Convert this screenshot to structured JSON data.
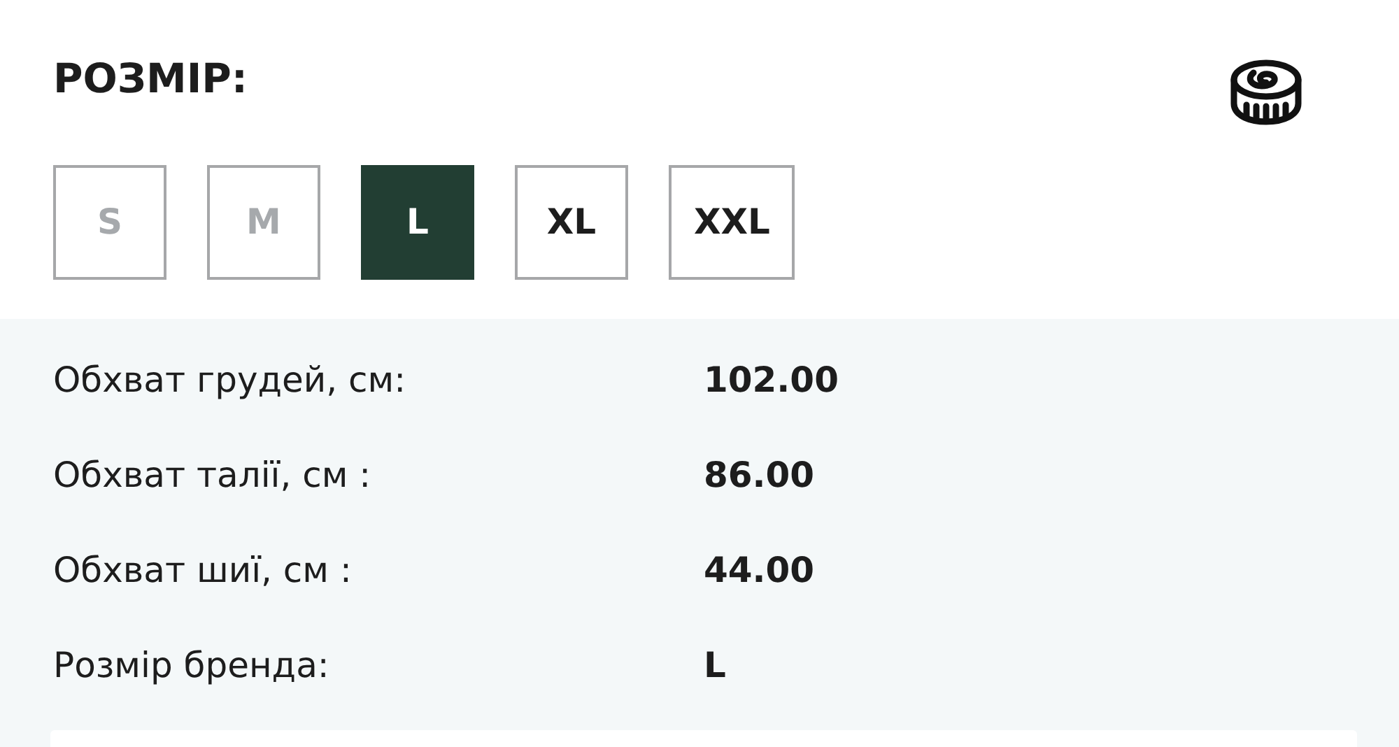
{
  "heading": "РОЗМІР:",
  "sizes": [
    {
      "label": "S",
      "selected": false,
      "disabled": true
    },
    {
      "label": "M",
      "selected": false,
      "disabled": true
    },
    {
      "label": "L",
      "selected": true,
      "disabled": false
    },
    {
      "label": "XL",
      "selected": false,
      "disabled": false
    },
    {
      "label": "XXL",
      "selected": false,
      "disabled": false
    }
  ],
  "measurements": [
    {
      "label": "Обхват грудей, см:",
      "value": "102.00"
    },
    {
      "label": "Обхват талії, см :",
      "value": "86.00"
    },
    {
      "label": "Обхват шиї, см :",
      "value": "44.00"
    },
    {
      "label": "Розмір бренда:",
      "value": "L"
    }
  ]
}
